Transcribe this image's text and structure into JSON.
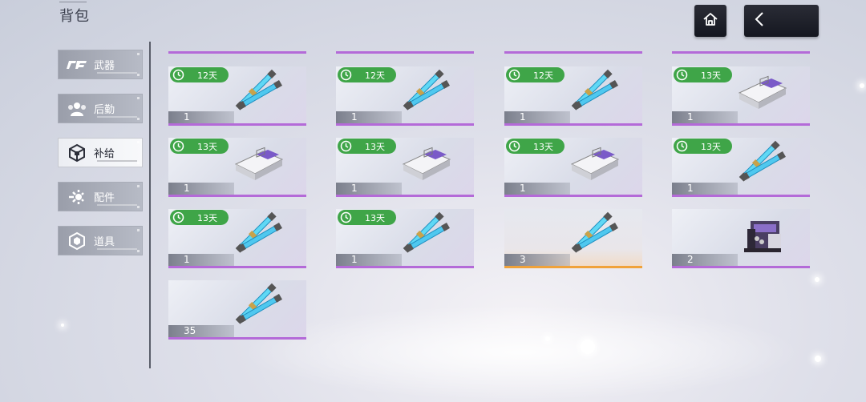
{
  "header": {
    "title": "背包"
  },
  "sidebar": {
    "items": [
      {
        "label": "武器",
        "icon": "weapon-logo-icon",
        "active": false
      },
      {
        "label": "后勤",
        "icon": "people-icon",
        "active": false
      },
      {
        "label": "补给",
        "icon": "cube-icon",
        "active": true
      },
      {
        "label": "配件",
        "icon": "gear-parts-icon",
        "active": false
      },
      {
        "label": "道具",
        "icon": "hexagon-icon",
        "active": false
      }
    ]
  },
  "inventory": {
    "items": [
      {
        "timer": "12天",
        "qty": "1",
        "art": "syringe",
        "rarity": "purple"
      },
      {
        "timer": "12天",
        "qty": "1",
        "art": "syringe",
        "rarity": "purple"
      },
      {
        "timer": "12天",
        "qty": "1",
        "art": "syringe",
        "rarity": "purple"
      },
      {
        "timer": "13天",
        "qty": "1",
        "art": "box",
        "rarity": "purple"
      },
      {
        "timer": "13天",
        "qty": "1",
        "art": "box",
        "rarity": "purple"
      },
      {
        "timer": "13天",
        "qty": "1",
        "art": "box",
        "rarity": "purple"
      },
      {
        "timer": "13天",
        "qty": "1",
        "art": "box",
        "rarity": "purple"
      },
      {
        "timer": "13天",
        "qty": "1",
        "art": "syringe",
        "rarity": "purple"
      },
      {
        "timer": "13天",
        "qty": "1",
        "art": "syringe",
        "rarity": "purple"
      },
      {
        "timer": "13天",
        "qty": "1",
        "art": "syringe",
        "rarity": "purple"
      },
      {
        "timer": "",
        "qty": "3",
        "art": "syringe",
        "rarity": "orange"
      },
      {
        "timer": "",
        "qty": "2",
        "art": "machine",
        "rarity": "purple"
      },
      {
        "timer": "",
        "qty": "35",
        "art": "syringe",
        "rarity": "purple"
      }
    ]
  },
  "colors": {
    "accent_purple": "#b46ad8",
    "accent_orange": "#f0a23a",
    "timer_green": "#3fa548"
  }
}
